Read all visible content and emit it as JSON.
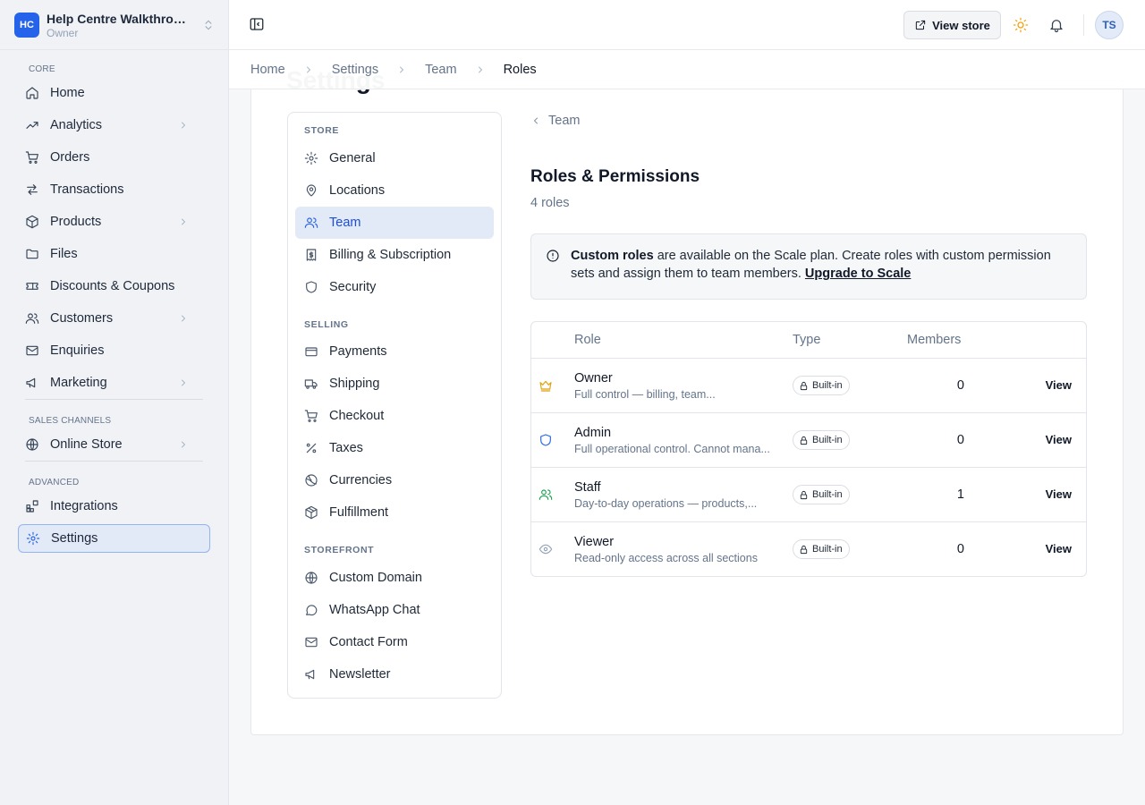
{
  "workspace": {
    "initials": "HC",
    "name": "Help Centre Walkthrough",
    "role": "Owner"
  },
  "sidebar": {
    "sections": {
      "core": "CORE",
      "sales": "SALES CHANNELS",
      "advanced": "ADVANCED"
    },
    "items": [
      {
        "label": "Home",
        "icon": "home-icon"
      },
      {
        "label": "Analytics",
        "icon": "trending-up-icon"
      },
      {
        "label": "Orders",
        "icon": "cart-icon"
      },
      {
        "label": "Transactions",
        "icon": "arrows-icon"
      },
      {
        "label": "Products",
        "icon": "box-icon"
      },
      {
        "label": "Files",
        "icon": "folder-icon"
      },
      {
        "label": "Discounts & Coupons",
        "icon": "ticket-icon"
      },
      {
        "label": "Customers",
        "icon": "users-icon"
      },
      {
        "label": "Enquiries",
        "icon": "mail-icon"
      },
      {
        "label": "Marketing",
        "icon": "megaphone-icon"
      },
      {
        "label": "Online Store",
        "icon": "globe-icon"
      },
      {
        "label": "Integrations",
        "icon": "blocks-icon"
      },
      {
        "label": "Settings",
        "icon": "gear-icon"
      }
    ]
  },
  "header": {
    "view_store": "View store",
    "avatar": "TS"
  },
  "breadcrumb": [
    "Home",
    "Settings",
    "Team",
    "Roles"
  ],
  "page_title": "Settings",
  "settings_nav": {
    "store_heading": "STORE",
    "selling_heading": "SELLING",
    "storefront_heading": "STOREFRONT",
    "items": [
      "General",
      "Locations",
      "Team",
      "Billing & Subscription",
      "Security",
      "Payments",
      "Shipping",
      "Checkout",
      "Taxes",
      "Currencies",
      "Fulfillment",
      "Custom Domain",
      "WhatsApp Chat",
      "Contact Form",
      "Newsletter"
    ]
  },
  "content": {
    "back": "Team",
    "title": "Roles & Permissions",
    "subtitle": "4 roles",
    "banner": {
      "strong": "Custom roles",
      "text": " are available on the Scale plan. Create roles with custom permission sets and assign them to team members. ",
      "link": "Upgrade to Scale"
    },
    "table": {
      "headers": {
        "role": "Role",
        "type": "Type",
        "members": "Members"
      },
      "rows": [
        {
          "name": "Owner",
          "desc": "Full control — billing, team...",
          "type": "Built-in",
          "members": "0",
          "action": "View",
          "icon": "crown-icon",
          "icon_color": "#e0a10a"
        },
        {
          "name": "Admin",
          "desc": "Full operational control. Cannot mana...",
          "type": "Built-in",
          "members": "0",
          "action": "View",
          "icon": "shield-icon",
          "icon_color": "#2563eb"
        },
        {
          "name": "Staff",
          "desc": "Day-to-day operations — products,...",
          "type": "Built-in",
          "members": "1",
          "action": "View",
          "icon": "users-icon",
          "icon_color": "#16a34a"
        },
        {
          "name": "Viewer",
          "desc": "Read-only access across all sections",
          "type": "Built-in",
          "members": "0",
          "action": "View",
          "icon": "eye-icon",
          "icon_color": "#94a3b8"
        }
      ]
    }
  }
}
